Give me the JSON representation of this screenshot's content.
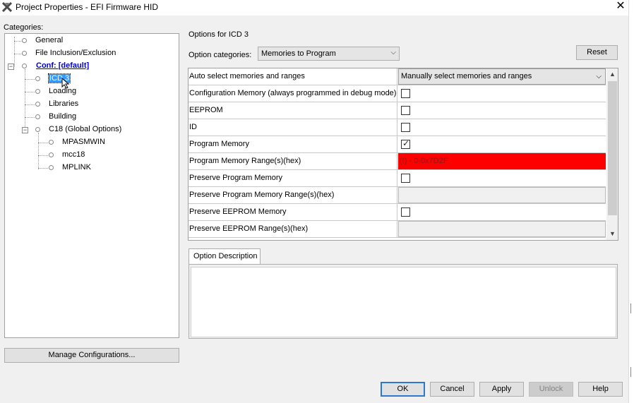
{
  "window": {
    "title": "Project Properties - EFI Firmware HID",
    "app_icon": "mplab-x-icon",
    "close_glyph": "✕"
  },
  "categories": {
    "label": "Categories:",
    "tree": {
      "general": "General",
      "file_inclusion": "File Inclusion/Exclusion",
      "conf": "Conf: [default]",
      "icd3": "ICD 3",
      "loading": "Loading",
      "libraries": "Libraries",
      "building": "Building",
      "c18": "C18 (Global Options)",
      "mpasmwin": "MPASMWIN",
      "mcc18": "mcc18",
      "mplink": "MPLINK"
    },
    "expander_collapse": "−"
  },
  "manage_button": "Manage Configurations...",
  "options": {
    "heading": "Options for ICD 3",
    "categories_label": "Option categories:",
    "categories_value": "Memories to Program",
    "reset_button": "Reset",
    "dropdown_arrow": "⌵",
    "rows": [
      {
        "name": "Auto select memories and ranges",
        "type": "combo",
        "value": "Manually select memories and ranges"
      },
      {
        "name": "Configuration Memory (always programmed in debug mode)",
        "type": "checkbox",
        "checked": false
      },
      {
        "name": "EEPROM",
        "type": "checkbox",
        "checked": false
      },
      {
        "name": "ID",
        "type": "checkbox",
        "checked": false
      },
      {
        "name": "Program Memory",
        "type": "checkbox",
        "checked": true
      },
      {
        "name": "Program Memory Range(s)(hex)",
        "type": "text-error",
        "value": "(!) - 0-0x7D2F"
      },
      {
        "name": "Preserve Program Memory",
        "type": "checkbox",
        "checked": false
      },
      {
        "name": "Preserve Program Memory Range(s)(hex)",
        "type": "disabled",
        "value": ""
      },
      {
        "name": "Preserve EEPROM Memory",
        "type": "checkbox",
        "checked": false
      },
      {
        "name": "Preserve EEPROM Range(s)(hex)",
        "type": "disabled",
        "value": ""
      }
    ],
    "check_glyph": "✓",
    "error_color": "#ff0000",
    "scroll_up": "▲",
    "scroll_down": "▼"
  },
  "description": {
    "tab_label": "Option Description",
    "text": ""
  },
  "buttons": {
    "ok": "OK",
    "cancel": "Cancel",
    "apply": "Apply",
    "unlock": "Unlock",
    "help": "Help"
  }
}
